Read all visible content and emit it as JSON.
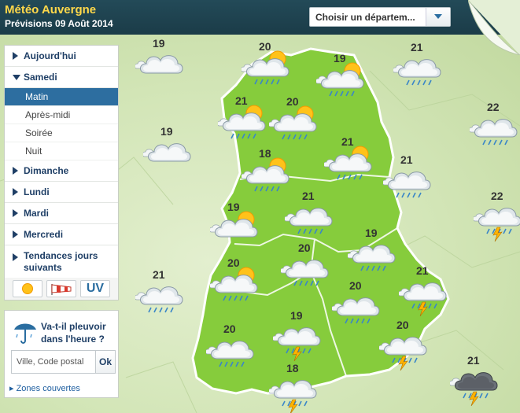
{
  "header": {
    "title": "Météo Auvergne",
    "subtitle": "Prévisions 09 Août 2014",
    "department_select": "Choisir un départem..."
  },
  "menu": {
    "items": [
      {
        "label": "Aujourd'hui"
      },
      {
        "label": "Samedi"
      },
      {
        "label": "Dimanche"
      },
      {
        "label": "Lundi"
      },
      {
        "label": "Mardi"
      },
      {
        "label": "Mercredi"
      },
      {
        "label": "Tendances jours suivants"
      }
    ],
    "subitems": [
      {
        "label": "Matin"
      },
      {
        "label": "Après-midi"
      },
      {
        "label": "Soirée"
      },
      {
        "label": "Nuit"
      }
    ],
    "uv_label": "UV"
  },
  "rain": {
    "question": "Va-t-il pleuvoir dans l'heure ?",
    "input_placeholder": "Ville, Code postal",
    "ok_label": "Ok",
    "zones_link": "Zones couvertes"
  },
  "forecasts": [
    {
      "temp": "19",
      "icon": "cloud-icon"
    },
    {
      "temp": "20",
      "icon": "sun-cloud-rain-icon"
    },
    {
      "temp": "19",
      "icon": "sun-cloud-rain-icon"
    },
    {
      "temp": "21",
      "icon": "cloud-rain-icon"
    },
    {
      "temp": "21",
      "icon": "sun-cloud-rain-icon"
    },
    {
      "temp": "20",
      "icon": "sun-cloud-rain-icon"
    },
    {
      "temp": "22",
      "icon": "cloud-rain-icon"
    },
    {
      "temp": "19",
      "icon": "cloud-icon"
    },
    {
      "temp": "21",
      "icon": "sun-cloud-rain-icon"
    },
    {
      "temp": "18",
      "icon": "sun-cloud-rain-icon"
    },
    {
      "temp": "21",
      "icon": "cloud-rain-icon"
    },
    {
      "temp": "21",
      "icon": "cloud-rain-icon"
    },
    {
      "temp": "22",
      "icon": "cloud-storm-icon"
    },
    {
      "temp": "19",
      "icon": "sun-cloud-icon"
    },
    {
      "temp": "19",
      "icon": "cloud-rain-icon"
    },
    {
      "temp": "20",
      "icon": "cloud-rain-icon"
    },
    {
      "temp": "20",
      "icon": "sun-cloud-rain-icon"
    },
    {
      "temp": "21",
      "icon": "cloud-rain-icon"
    },
    {
      "temp": "21",
      "icon": "cloud-storm-icon"
    },
    {
      "temp": "20",
      "icon": "cloud-rain-icon"
    },
    {
      "temp": "19",
      "icon": "cloud-storm-icon"
    },
    {
      "temp": "20",
      "icon": "cloud-rain-icon"
    },
    {
      "temp": "20",
      "icon": "cloud-storm-icon"
    },
    {
      "temp": "18",
      "icon": "cloud-storm-icon"
    },
    {
      "temp": "21",
      "icon": "dark-cloud-storm-icon"
    }
  ],
  "colors": {
    "region": "#86cc3c",
    "region_stroke": "#ffffff",
    "header": "#1f4350",
    "title": "#ffd84a",
    "active": "#2d6ea0"
  }
}
